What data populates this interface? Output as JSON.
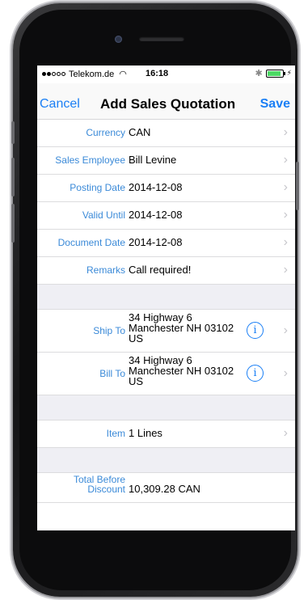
{
  "status_bar": {
    "carrier": "Telekom.de",
    "time": "16:18"
  },
  "nav": {
    "cancel_label": "Cancel",
    "title": "Add Sales Quotation",
    "save_label": "Save"
  },
  "fields": {
    "currency": {
      "label": "Currency",
      "value": "CAN"
    },
    "sales_employee": {
      "label": "Sales Employee",
      "value": "Bill Levine"
    },
    "posting_date": {
      "label": "Posting Date",
      "value": "2014-12-08"
    },
    "valid_until": {
      "label": "Valid Until",
      "value": "2014-12-08"
    },
    "document_date": {
      "label": "Document Date",
      "value": "2014-12-08"
    },
    "remarks": {
      "label": "Remarks",
      "value": "Call required!"
    }
  },
  "addresses": {
    "ship_to": {
      "label": "Ship To",
      "line1": "34 Highway 6",
      "line2": "Manchester NH 03102",
      "line3": "US"
    },
    "bill_to": {
      "label": "Bill To",
      "line1": "34 Highway 6",
      "line2": "Manchester NH 03102",
      "line3": "US"
    }
  },
  "item": {
    "label": "Item",
    "value": "1 Lines"
  },
  "totals": {
    "before_discount_label_1": "Total Before",
    "before_discount_label_2": "Discount",
    "before_discount_value": "10,309.28 CAN"
  },
  "icons": {
    "chevron": "chevron-right-icon",
    "info": "info-icon",
    "wifi": "wifi-icon",
    "bluetooth": "bluetooth-icon",
    "battery": "battery-icon"
  },
  "colors": {
    "accent": "#1a7ff5",
    "label": "#3b8ad8",
    "section_gap": "#efeff4"
  }
}
